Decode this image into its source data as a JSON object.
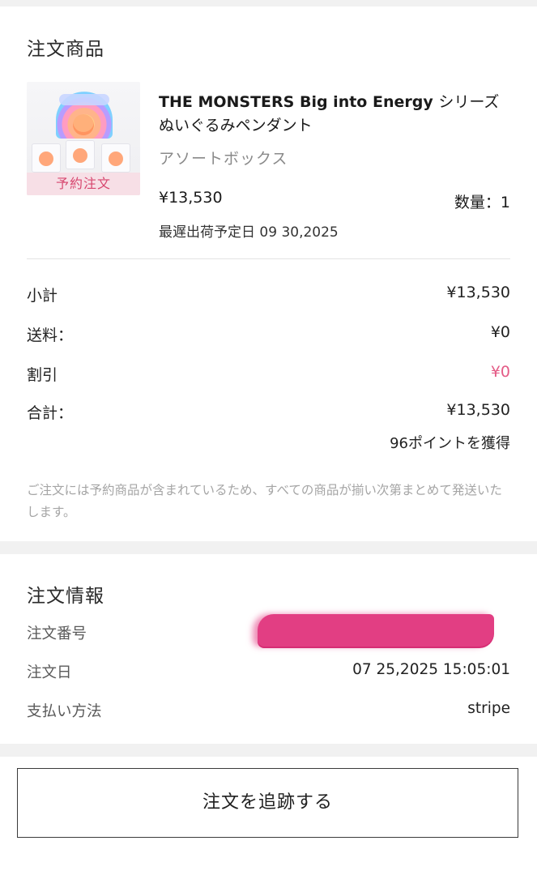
{
  "order_items": {
    "title": "注文商品",
    "product": {
      "thumb_tag": "予約注文",
      "name_line1_en": "THE MONSTERS Big into Energy ",
      "name_line1_jp": "シリーズ",
      "name_line2": "ぬいぐるみペンダント",
      "variant": "アソートボックス",
      "price": "¥13,530",
      "quantity_text": "数量：1",
      "ship_date_text": "最遅出荷予定日 09 30,2025"
    },
    "summary": [
      {
        "label": "小計",
        "value": "¥13,530"
      },
      {
        "label": "送料：",
        "value": "¥0"
      },
      {
        "label": "割引",
        "value": "¥0"
      },
      {
        "label": "合計：",
        "value": "¥13,530"
      }
    ],
    "points_text": "96ポイントを獲得",
    "notice": "ご注文には予約商品が含まれているため、すべての商品が揃い次第まとめて発送いたします。"
  },
  "order_info": {
    "title": "注文情報",
    "rows": [
      {
        "label": "注文番号",
        "value": ""
      },
      {
        "label": "注文日",
        "value": "07 25,2025 15:05:01"
      },
      {
        "label": "支払い方法",
        "value": "stripe"
      }
    ]
  },
  "actions": {
    "track_label": "注文を追跡する"
  },
  "colors": {
    "accent_pink": "#e45b86",
    "redaction": "#e23e83"
  }
}
